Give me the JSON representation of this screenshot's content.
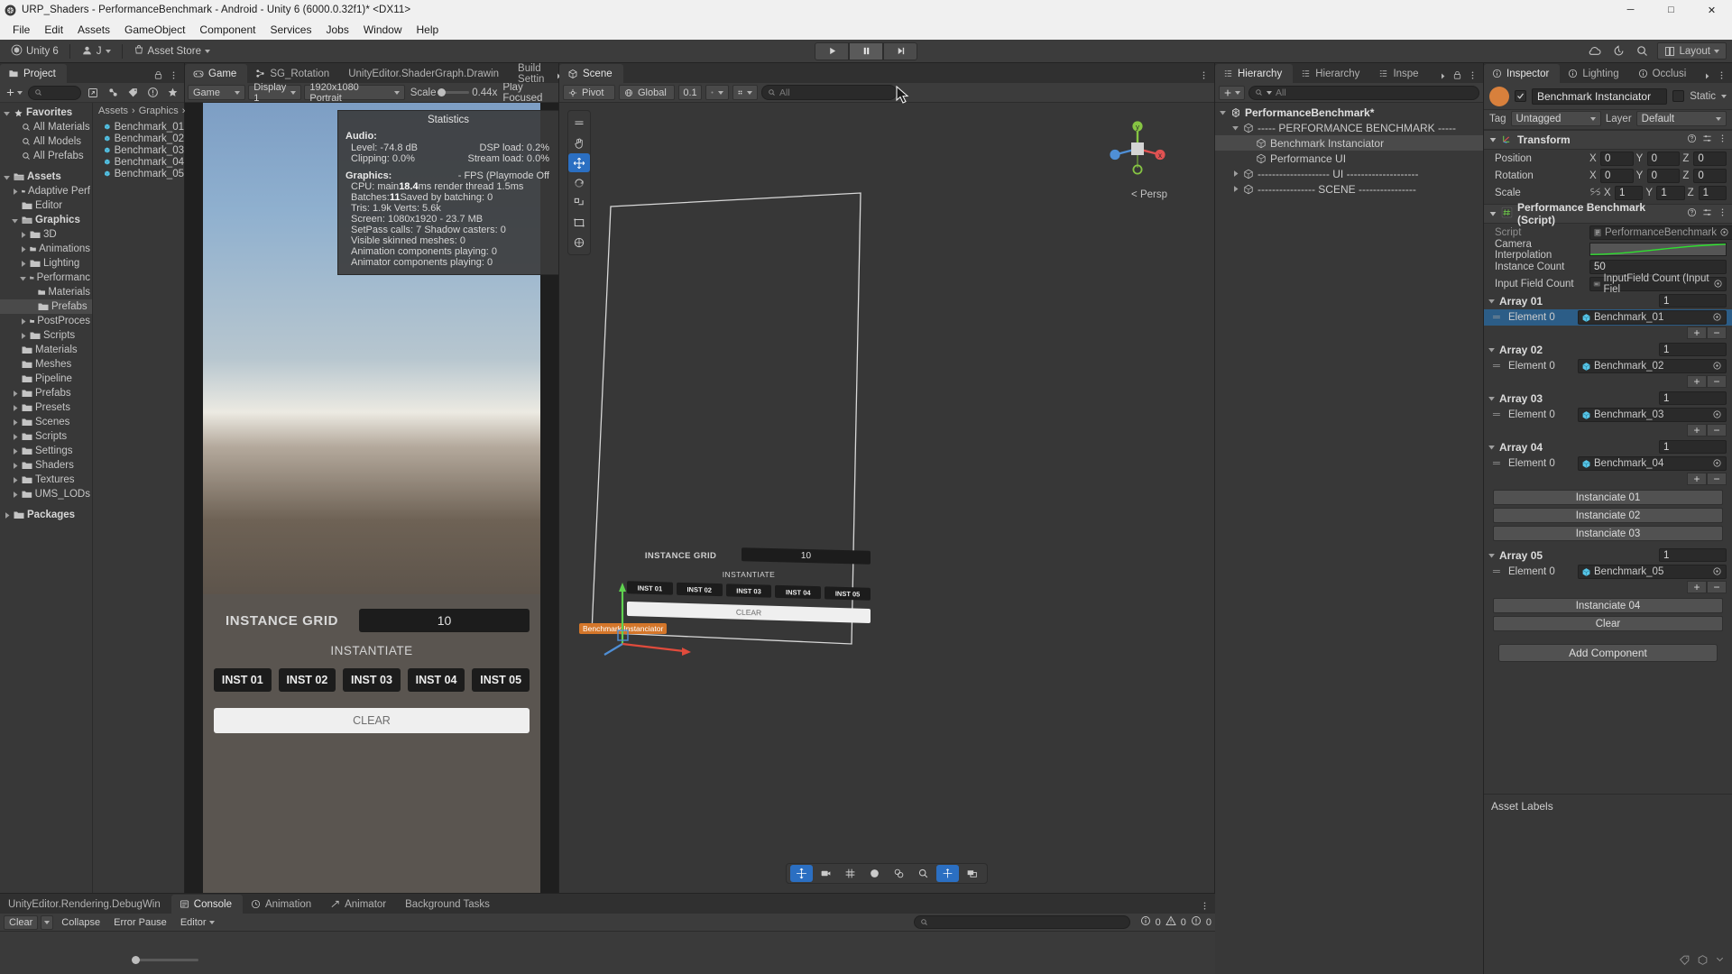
{
  "window": {
    "title": "URP_Shaders - PerformanceBenchmark - Android - Unity 6 (6000.0.32f1)* <DX11>",
    "minimize": "─",
    "maximize": "□",
    "close": "✕"
  },
  "menu": {
    "items": [
      "File",
      "Edit",
      "Assets",
      "GameObject",
      "Component",
      "Services",
      "Jobs",
      "Window",
      "Help"
    ]
  },
  "toolbar": {
    "unity_label": "Unity 6",
    "account_label": "J",
    "asset_store_label": "Asset Store",
    "play": "▶",
    "pause": "❙❙",
    "step": "▶❘",
    "layout_label": "Layout"
  },
  "project": {
    "tab": "Project",
    "search_placeholder": "",
    "breadcrumb": [
      "Assets",
      "Graphics"
    ],
    "tree": [
      {
        "label": "Favorites",
        "depth": 0,
        "tri": "down",
        "icon": "star",
        "bold": true
      },
      {
        "label": "All Materials",
        "depth": 1,
        "tri": "none",
        "icon": "search"
      },
      {
        "label": "All Models",
        "depth": 1,
        "tri": "none",
        "icon": "search"
      },
      {
        "label": "All Prefabs",
        "depth": 1,
        "tri": "none",
        "icon": "search"
      },
      {
        "label": "",
        "depth": 0,
        "tri": "none",
        "icon": "none",
        "spacer": true
      },
      {
        "label": "Assets",
        "depth": 0,
        "tri": "down",
        "icon": "folder-open",
        "bold": true
      },
      {
        "label": "Adaptive Perf",
        "depth": 1,
        "tri": "right",
        "icon": "folder"
      },
      {
        "label": "Editor",
        "depth": 1,
        "tri": "none",
        "icon": "folder"
      },
      {
        "label": "Graphics",
        "depth": 1,
        "tri": "down",
        "icon": "folder-open",
        "bold": true
      },
      {
        "label": "3D",
        "depth": 2,
        "tri": "right",
        "icon": "folder"
      },
      {
        "label": "Animations",
        "depth": 2,
        "tri": "right",
        "icon": "folder"
      },
      {
        "label": "Lighting",
        "depth": 2,
        "tri": "right",
        "icon": "folder"
      },
      {
        "label": "Performanc",
        "depth": 2,
        "tri": "down",
        "icon": "folder-open"
      },
      {
        "label": "Materials",
        "depth": 3,
        "tri": "none",
        "icon": "folder"
      },
      {
        "label": "Prefabs",
        "depth": 3,
        "tri": "none",
        "icon": "folder",
        "selected": true
      },
      {
        "label": "PostProces",
        "depth": 2,
        "tri": "right",
        "icon": "folder"
      },
      {
        "label": "Scripts",
        "depth": 2,
        "tri": "right",
        "icon": "folder"
      },
      {
        "label": "Materials",
        "depth": 1,
        "tri": "none",
        "icon": "folder"
      },
      {
        "label": "Meshes",
        "depth": 1,
        "tri": "none",
        "icon": "folder"
      },
      {
        "label": "Pipeline",
        "depth": 1,
        "tri": "none",
        "icon": "folder"
      },
      {
        "label": "Prefabs",
        "depth": 1,
        "tri": "right",
        "icon": "folder"
      },
      {
        "label": "Presets",
        "depth": 1,
        "tri": "right",
        "icon": "folder"
      },
      {
        "label": "Scenes",
        "depth": 1,
        "tri": "right",
        "icon": "folder"
      },
      {
        "label": "Scripts",
        "depth": 1,
        "tri": "right",
        "icon": "folder"
      },
      {
        "label": "Settings",
        "depth": 1,
        "tri": "right",
        "icon": "folder"
      },
      {
        "label": "Shaders",
        "depth": 1,
        "tri": "right",
        "icon": "folder"
      },
      {
        "label": "Textures",
        "depth": 1,
        "tri": "right",
        "icon": "folder"
      },
      {
        "label": "UMS_LODs",
        "depth": 1,
        "tri": "right",
        "icon": "folder"
      },
      {
        "label": "",
        "depth": 0,
        "tri": "none",
        "icon": "none",
        "spacer": true
      },
      {
        "label": "Packages",
        "depth": 0,
        "tri": "right",
        "icon": "folder",
        "bold": true
      }
    ],
    "assets": [
      {
        "label": "Benchmark_01"
      },
      {
        "label": "Benchmark_02"
      },
      {
        "label": "Benchmark_03"
      },
      {
        "label": "Benchmark_04"
      },
      {
        "label": "Benchmark_05"
      }
    ]
  },
  "game": {
    "tabs": [
      {
        "label": "Game",
        "icon": "game-icon",
        "active": true
      },
      {
        "label": "SG_Rotation",
        "icon": "shadergraph-icon",
        "active": false
      },
      {
        "label": "UnityEditor.ShaderGraph.Drawin",
        "icon": "none",
        "active": false
      },
      {
        "label": "Build Settin",
        "icon": "none",
        "active": false
      }
    ],
    "toolbar": {
      "view_label": "Game",
      "display": "Display 1",
      "resolution": "1920x1080 Portrait",
      "scale_label": "Scale",
      "scale_value": "0.44x",
      "play_focused": "Play Focused"
    },
    "statistics": {
      "title": "Statistics",
      "audio_header": "Audio:",
      "audio": [
        {
          "left": "Level: -74.8 dB",
          "right": "DSP load: 0.2%"
        },
        {
          "left": "Clipping: 0.0%",
          "right": "Stream load: 0.0%"
        }
      ],
      "graphics_header": "Graphics:",
      "graphics_right": "- FPS (Playmode Off",
      "graphics": [
        {
          "text": "CPU: main ",
          "bold": "18.4",
          "rest": "ms  render thread 1.5ms"
        },
        {
          "text": "Batches: ",
          "bold": "11",
          "rest": "      Saved by batching: 0"
        },
        {
          "text": "Tris: 1.9k  Verts: 5.6k",
          "bold": "",
          "rest": ""
        },
        {
          "text": "Screen: 1080x1920 - 23.7 MB",
          "bold": "",
          "rest": ""
        },
        {
          "text": "SetPass calls: 7  Shadow casters: 0",
          "bold": "",
          "rest": ""
        },
        {
          "text": "Visible skinned meshes: 0",
          "bold": "",
          "rest": ""
        },
        {
          "text": "Animation components playing: 0",
          "bold": "",
          "rest": ""
        },
        {
          "text": "Animator components playing: 0",
          "bold": "",
          "rest": ""
        }
      ]
    },
    "ui": {
      "instance_grid_label": "INSTANCE GRID",
      "instance_grid_value": "10",
      "instantiate_label": "INSTANTIATE",
      "inst_buttons": [
        "INST 01",
        "INST 02",
        "INST 03",
        "INST 04",
        "INST 05"
      ],
      "clear_label": "CLEAR"
    }
  },
  "scene": {
    "tab": "Scene",
    "toolbar": {
      "pivot": "Pivot",
      "global": "Global",
      "grid_value": "0.1",
      "search_placeholder": "All"
    },
    "persp_label": "< Persp",
    "gizmo_axes": {
      "x": "x",
      "y": "y",
      "z": "z"
    },
    "object_label": "Benchmark Instanciator",
    "ui": {
      "instance_grid_label": "INSTANCE GRID",
      "instance_grid_value": "10",
      "instantiate_label": "INSTANTIATE",
      "inst_buttons": [
        "INST 01",
        "INST 02",
        "INST 03",
        "INST 04",
        "INST 05"
      ],
      "clear_label": "CLEAR"
    }
  },
  "hierarchy": {
    "tabs": [
      {
        "label": "Hierarchy",
        "active": true
      },
      {
        "label": "Hierarchy",
        "active": false
      },
      {
        "label": "Inspe",
        "active": false
      }
    ],
    "search_placeholder": "All",
    "add_label": "+",
    "rows": [
      {
        "label": "PerformanceBenchmark*",
        "depth": 0,
        "tri": "down",
        "icon": "unity",
        "bold": true
      },
      {
        "label": "----- PERFORMANCE BENCHMARK -----",
        "depth": 1,
        "tri": "down",
        "icon": "cube"
      },
      {
        "label": "Benchmark Instanciator",
        "depth": 2,
        "tri": "none",
        "icon": "cube",
        "selected": true
      },
      {
        "label": "Performance UI",
        "depth": 2,
        "tri": "none",
        "icon": "cube"
      },
      {
        "label": "-------------------- UI --------------------",
        "depth": 1,
        "tri": "right",
        "icon": "cube"
      },
      {
        "label": "---------------- SCENE ----------------",
        "depth": 1,
        "tri": "right",
        "icon": "cube"
      }
    ]
  },
  "inspector": {
    "tabs": [
      {
        "label": "Inspector",
        "active": true
      },
      {
        "label": "Lighting",
        "active": false
      },
      {
        "label": "Occlusi",
        "active": false
      }
    ],
    "object_name": "Benchmark Instanciator",
    "static_label": "Static",
    "tag_label": "Tag",
    "tag_value": "Untagged",
    "layer_label": "Layer",
    "layer_value": "Default",
    "transform": {
      "title": "Transform",
      "rows": [
        {
          "label": "Position",
          "x": "0",
          "y": "0",
          "z": "0"
        },
        {
          "label": "Rotation",
          "x": "0",
          "y": "0",
          "z": "0"
        },
        {
          "label": "Scale",
          "x": "1",
          "y": "1",
          "z": "1"
        }
      ]
    },
    "script_component": {
      "title": "Performance Benchmark (Script)",
      "script_label": "Script",
      "script_value": "PerformanceBenchmark",
      "camera_interp_label": "Camera Interpolation",
      "instance_count_label": "Instance Count",
      "instance_count_value": "50",
      "input_field_label": "Input Field Count",
      "input_field_value": "InputField Count (Input Fiel"
    },
    "arrays": [
      {
        "name": "Array 01",
        "size": "1",
        "element_label": "Element 0",
        "element_value": "Benchmark_01",
        "selected": true
      },
      {
        "name": "Array 02",
        "size": "1",
        "element_label": "Element 0",
        "element_value": "Benchmark_02",
        "selected": false
      },
      {
        "name": "Array 03",
        "size": "1",
        "element_label": "Element 0",
        "element_value": "Benchmark_03",
        "selected": false
      },
      {
        "name": "Array 04",
        "size": "1",
        "element_label": "Element 0",
        "element_value": "Benchmark_04",
        "selected": false
      }
    ],
    "mid_buttons": [
      "Instanciate 01",
      "Instanciate 02",
      "Instanciate 03"
    ],
    "array5": {
      "name": "Array 05",
      "size": "1",
      "element_label": "Element 0",
      "element_value": "Benchmark_05"
    },
    "tail_buttons": [
      "Instanciate 04",
      "Clear"
    ],
    "add_component": "Add Component",
    "asset_labels": "Asset Labels",
    "plus": "+",
    "minus": "−"
  },
  "console": {
    "tabs": [
      {
        "label": "UnityEditor.Rendering.DebugWin",
        "active": false
      },
      {
        "label": "Console",
        "active": true
      },
      {
        "label": "Animation",
        "active": false
      },
      {
        "label": "Animator",
        "active": false
      },
      {
        "label": "Background Tasks",
        "active": false
      }
    ],
    "clear_label": "Clear",
    "collapse_label": "Collapse",
    "error_pause_label": "Error Pause",
    "editor_label": "Editor",
    "search_placeholder": "",
    "counts": {
      "info": "0",
      "warning": "0",
      "error": "0"
    }
  },
  "colors": {
    "accent_blue": "#2c5d87",
    "selection": "#4a4a4a",
    "panel_bg": "#383838",
    "toolbar_bg": "#3c3c3c",
    "curve_green": "#2ee02e",
    "gameobject_orange": "#d8803c"
  }
}
